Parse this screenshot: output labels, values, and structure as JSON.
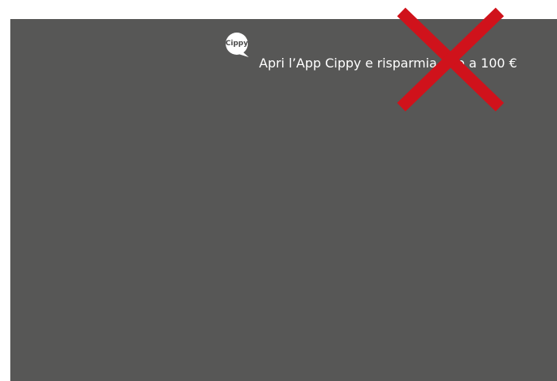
{
  "banner": {
    "logo_text": "Cippy",
    "promo_text": "Apri l’App Cippy e risparmia fino a 100 €",
    "background_color": "#575756",
    "text_color": "#ffffff"
  },
  "close_control": {
    "icon": "close-x-icon",
    "color": "#d0121b"
  }
}
